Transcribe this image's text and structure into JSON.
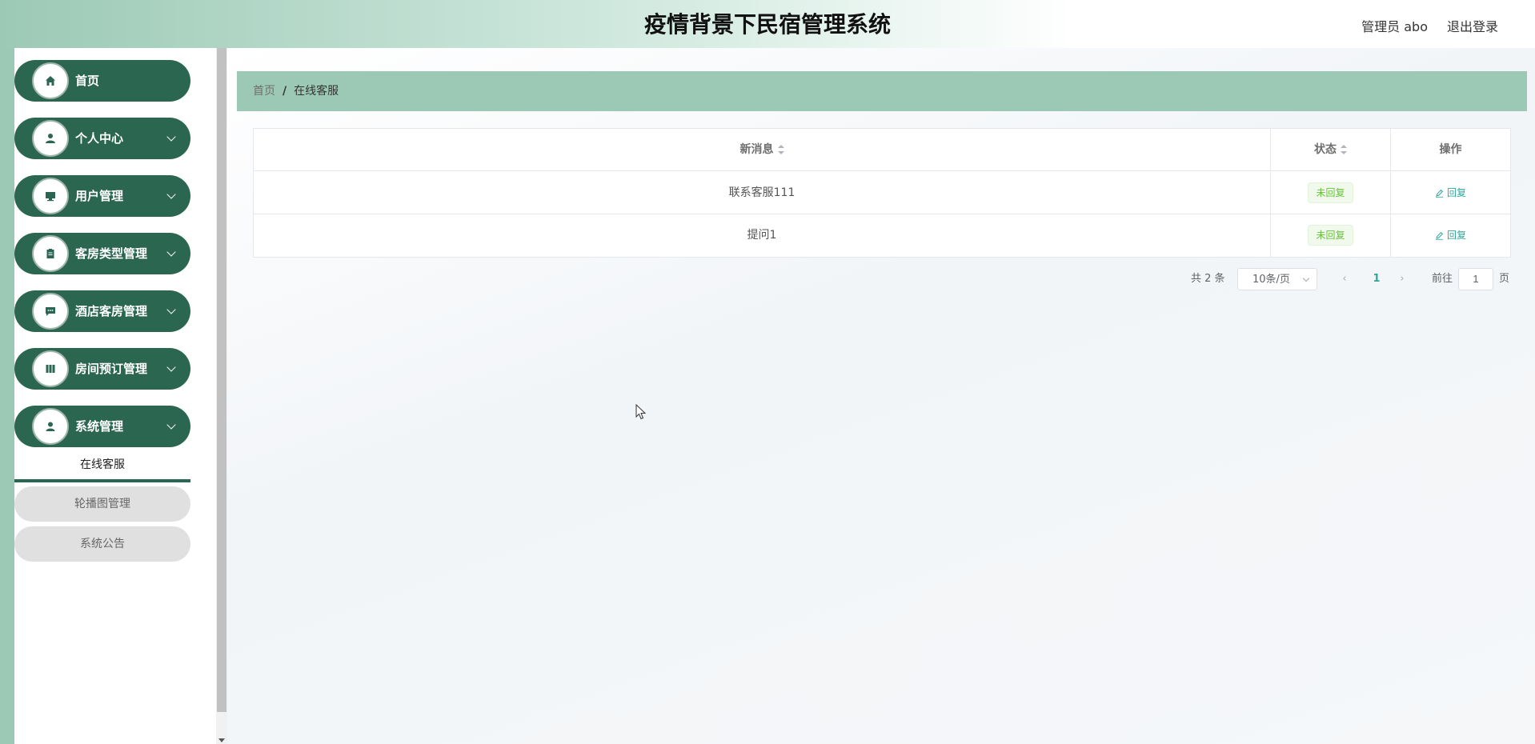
{
  "header": {
    "title": "疫情背景下民宿管理系统",
    "user": "管理员 abo",
    "logout": "退出登录"
  },
  "sidebar": {
    "items": [
      {
        "label": "首页",
        "icon": "home-icon"
      },
      {
        "label": "个人中心",
        "icon": "user-icon"
      },
      {
        "label": "用户管理",
        "icon": "monitor-icon"
      },
      {
        "label": "客房类型管理",
        "icon": "clipboard-icon"
      },
      {
        "label": "酒店客房管理",
        "icon": "chat-icon"
      },
      {
        "label": "房间预订管理",
        "icon": "book-icon"
      },
      {
        "label": "系统管理",
        "icon": "person-icon"
      }
    ],
    "submenu": {
      "active": "在线客服",
      "items": [
        "轮播图管理",
        "系统公告"
      ]
    }
  },
  "breadcrumb": {
    "home": "首页",
    "sep": "/",
    "current": "在线客服"
  },
  "table": {
    "headers": [
      "新消息",
      "状态",
      "操作"
    ],
    "rows": [
      {
        "message": "联系客服111",
        "status": "未回复",
        "action": "回复"
      },
      {
        "message": "提问1",
        "status": "未回复",
        "action": "回复"
      }
    ]
  },
  "pagination": {
    "total": "共 2 条",
    "page_size": "10条/页",
    "current_page": "1",
    "goto_label": "前往",
    "goto_value": "1",
    "page_unit": "页"
  },
  "colors": {
    "primary": "#2b6651",
    "accent": "#9cc9b6",
    "link": "#2ea79a"
  }
}
